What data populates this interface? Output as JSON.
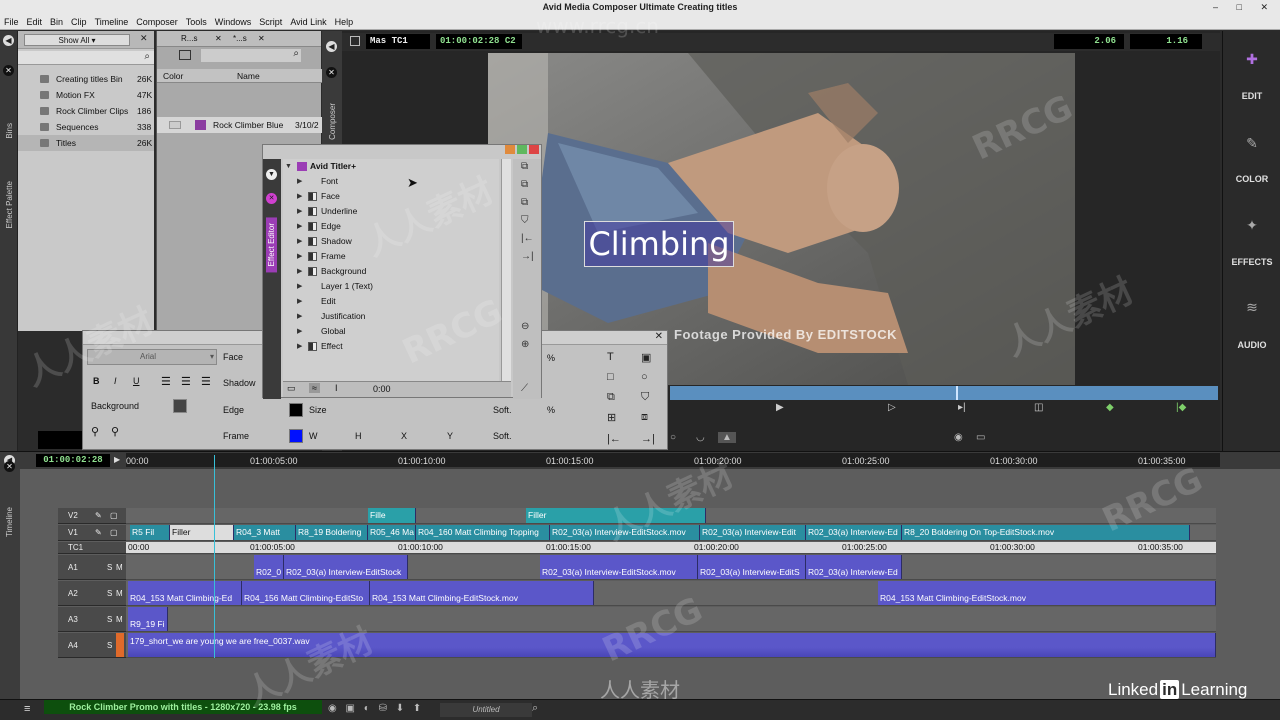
{
  "window": {
    "title": "Avid Media Composer Ultimate Creating titles",
    "controls": [
      "–",
      "□",
      "✕"
    ]
  },
  "menu": [
    "File",
    "Edit",
    "Bin",
    "Clip",
    "Timeline",
    "Composer",
    "Tools",
    "Windows",
    "Script",
    "Avid Link",
    "Help"
  ],
  "left_strip": {
    "bins_label": "Bins",
    "effect_palette_label": "Effect Palette"
  },
  "bins": {
    "filter": "Show All",
    "items": [
      {
        "name": "Creating titles Bin",
        "size": "26K"
      },
      {
        "name": "Motion FX",
        "size": "47K"
      },
      {
        "name": "Rock Climber Clips",
        "size": "186"
      },
      {
        "name": "Sequences",
        "size": "338"
      },
      {
        "name": "Titles",
        "size": "26K"
      }
    ]
  },
  "bin_content": {
    "tabs": [
      "R...s",
      "*...s"
    ],
    "columns": [
      "Color",
      "Name"
    ],
    "rows": [
      {
        "name": "Rock Climber Blue",
        "date": "3/10/2"
      }
    ]
  },
  "composer": {
    "label": "Composer",
    "track_label": "Mas TC1",
    "timecode": "01:00:02:28",
    "timecode_suffix": "C2",
    "readout_left": "2.06",
    "readout_right": "1.16",
    "overlay_title": "Climbing",
    "footage_credit": "Footage Provided By EDITSTOCK"
  },
  "right_bar": {
    "items": [
      {
        "label": "EDIT",
        "icon": "edit-icon"
      },
      {
        "label": "COLOR",
        "icon": "color-icon"
      },
      {
        "label": "EFFECTS",
        "icon": "effects-icon"
      },
      {
        "label": "AUDIO",
        "icon": "audio-icon"
      }
    ]
  },
  "effect_editor": {
    "side_label": "Effect Editor",
    "root": "Avid Titler+",
    "params": [
      "Font",
      "Face",
      "Underline",
      "Edge",
      "Shadow",
      "Frame",
      "Background",
      "Layer 1 (Text)",
      "Edit",
      "Justification",
      "Global",
      "Effect"
    ],
    "time": "0:00"
  },
  "title_tool": {
    "font": "Arial",
    "labels": {
      "face": "Face",
      "shadow": "Shadow",
      "edge": "Edge",
      "frame": "Frame",
      "background": "Background",
      "size": "Size",
      "soft": "Soft.",
      "soft2": "Soft.",
      "w": "W",
      "h": "H",
      "x": "X",
      "y": "Y",
      "pct": "%"
    },
    "style_buttons": [
      "B",
      "I",
      "U"
    ]
  },
  "timeline": {
    "side_label": "Timeline",
    "current_tc": "01:00:02:28",
    "ruler": [
      "00:00",
      "01:00:05:00",
      "01:00:10:00",
      "01:00:15:00",
      "01:00:20:00",
      "01:00:25:00",
      "01:00:30:00",
      "01:00:35:00"
    ],
    "tc_track": [
      "00:00",
      "01:00:05:00",
      "01:00:10:00",
      "01:00:15:00",
      "01:00:20:00",
      "01:00:25:00",
      "01:00:30:00",
      "01:00:35:00"
    ],
    "tracks": [
      {
        "name": "V2",
        "solo": "",
        "mute": ""
      },
      {
        "name": "V1",
        "solo": "",
        "mute": ""
      },
      {
        "name": "TC1",
        "solo": "",
        "mute": ""
      },
      {
        "name": "A1",
        "solo": "S",
        "mute": "M"
      },
      {
        "name": "A2",
        "solo": "S",
        "mute": "M"
      },
      {
        "name": "A3",
        "solo": "S",
        "mute": "M"
      },
      {
        "name": "A4",
        "solo": "S",
        "mute": "M"
      }
    ],
    "v2_clips": [
      "Fille",
      "Filler"
    ],
    "v1_clips": [
      "R5 Fil",
      "Filler",
      "R04_3 Matt",
      "R8_19 Boldering",
      "R05_46 Ma",
      "R04_160 Matt Climbing Topping",
      "R02_03(a) Interview-EditStock.mov",
      "R02_03(a) Interview-Edit",
      "R02_03(a) Interview-Ed",
      "R8_20 Boldering On Top-EditStock.mov"
    ],
    "a1_clips": [
      "R02_0",
      "R02_03(a) Interview-EditStock",
      "R02_03(a) Interview-EditStock.mov",
      "R02_03(a) Interview-EditS",
      "R02_03(a) Interview-Ed"
    ],
    "a2_clips": [
      "R04_153 Matt Climbing-Ed",
      "R04_156 Matt Climbing-EditSto",
      "R04_153 Matt Climbing-EditStock.mov",
      "R04_153 Matt Climbing-EditStock.mov"
    ],
    "a3_clips": [
      "R9_19 Fi"
    ],
    "a4_clips": [
      "179_short_we are young we are free_0037.wav"
    ]
  },
  "bottom": {
    "sequence": "Rock Climber Promo with titles - 1280x720 - 23.98 fps",
    "untitled": "Untitled",
    "brand": "Linked",
    "brand_in": "in",
    "brand_suffix": "Learning"
  },
  "watermarks": {
    "site": "www.rrcg.cn",
    "rrcg": "RRCG",
    "cn": "人人素材"
  },
  "colors": {
    "accent_purple": "#5b57c9",
    "video_clip": "#2a8ea0",
    "timecode_green": "#8fe08f"
  }
}
